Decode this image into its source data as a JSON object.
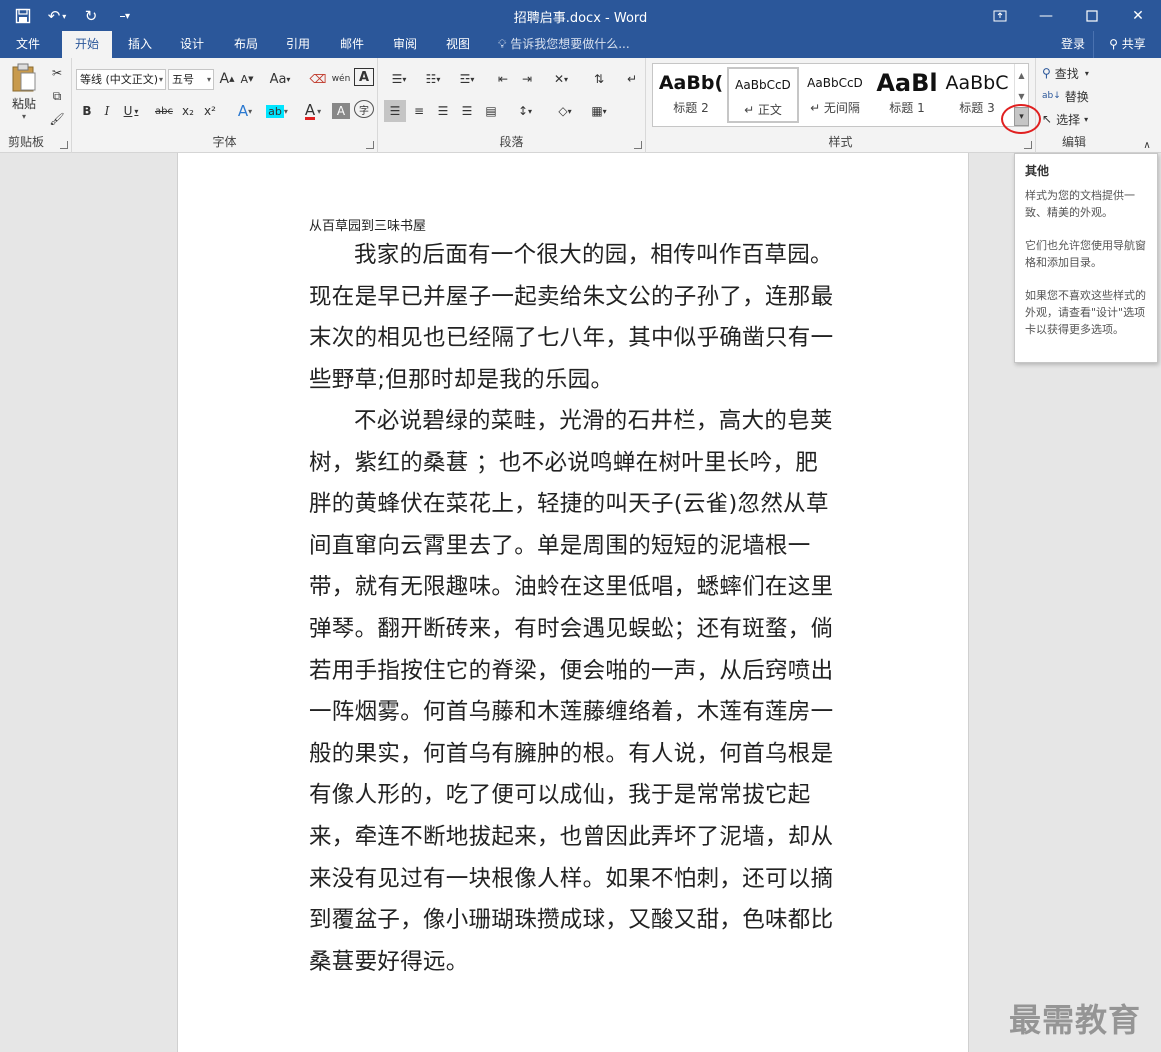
{
  "titlebar": {
    "title": "招聘启事.docx - Word",
    "save_icon": "save-icon",
    "undo_icon": "undo-icon",
    "redo_icon": "redo-icon"
  },
  "tabs": [
    {
      "label": "文件"
    },
    {
      "label": "开始"
    },
    {
      "label": "插入"
    },
    {
      "label": "设计"
    },
    {
      "label": "布局"
    },
    {
      "label": "引用"
    },
    {
      "label": "邮件"
    },
    {
      "label": "审阅"
    },
    {
      "label": "视图"
    }
  ],
  "tell_me": "告诉我您想要做什么...",
  "login": "登录",
  "share": "共享",
  "clipboard": {
    "paste": "粘贴",
    "label": "剪贴板"
  },
  "font": {
    "family": "等线 (中文正文)",
    "size": "五号",
    "label": "字体",
    "grow": "A",
    "shrink": "A",
    "case": "Aa",
    "bold": "B",
    "italic": "I",
    "underline": "U",
    "strike": "abc",
    "subscript": "x₂",
    "superscript": "x²",
    "phonetic": "wén",
    "border_char": "A",
    "effects": "A",
    "highlight": "ab",
    "color": "A",
    "shading": "A",
    "enclose": "字"
  },
  "paragraph": {
    "label": "段落"
  },
  "styles": {
    "label": "样式",
    "items": [
      {
        "sample": "AaBb(",
        "name": "标题 2"
      },
      {
        "sample": "AaBbCcD",
        "name": "↵ 正文"
      },
      {
        "sample": "AaBbCcD",
        "name": "↵ 无间隔"
      },
      {
        "sample": "AaBl",
        "name": "标题 1"
      },
      {
        "sample": "AaBbC",
        "name": "标题 3"
      }
    ]
  },
  "editing": {
    "label": "编辑",
    "find": "查找",
    "replace": "替换",
    "select": "选择"
  },
  "tooltip": {
    "title": "其他",
    "p1": "样式为您的文档提供一致、精美的外观。",
    "p2": "它们也允许您使用导航窗格和添加目录。",
    "p3": "如果您不喜欢这些样式的外观，请查看\"设计\"选项卡以获得更多选项。"
  },
  "document": {
    "heading": "从百草园到三味书屋",
    "para1": "我家的后面有一个很大的园，相传叫作百草园。现在是早已并屋子一起卖给朱文公的子孙了，连那最末次的相见也已经隔了七八年，其中似乎确凿只有一些野草;但那时却是我的乐园。",
    "para2": "不必说碧绿的菜畦，光滑的石井栏，高大的皂荚树，紫红的桑葚 ；也不必说鸣蝉在树叶里长吟，肥胖的黄蜂伏在菜花上，轻捷的叫天子(云雀)忽然从草间直窜向云霄里去了。单是周围的短短的泥墙根一带，就有无限趣味。油蛉在这里低唱，蟋蟀们在这里弹琴。翻开断砖来，有时会遇见蜈蚣；还有斑蝥，倘若用手指按住它的脊梁，便会啪的一声，从后窍喷出一阵烟雾。何首乌藤和木莲藤缠络着，木莲有莲房一般的果实，何首乌有臃肿的根。有人说，何首乌根是有像人形的，吃了便可以成仙，我于是常常拔它起来，牵连不断地拔起来，也曾因此弄坏了泥墙，却从来没有见过有一块根像人样。如果不怕刺，还可以摘到覆盆子，像小珊瑚珠攒成球，又酸又甜，色味都比桑葚要好得远。"
  },
  "watermark": "最需教育",
  "colors": {
    "brand": "#2b579a",
    "highlight_red": "#e02020"
  }
}
